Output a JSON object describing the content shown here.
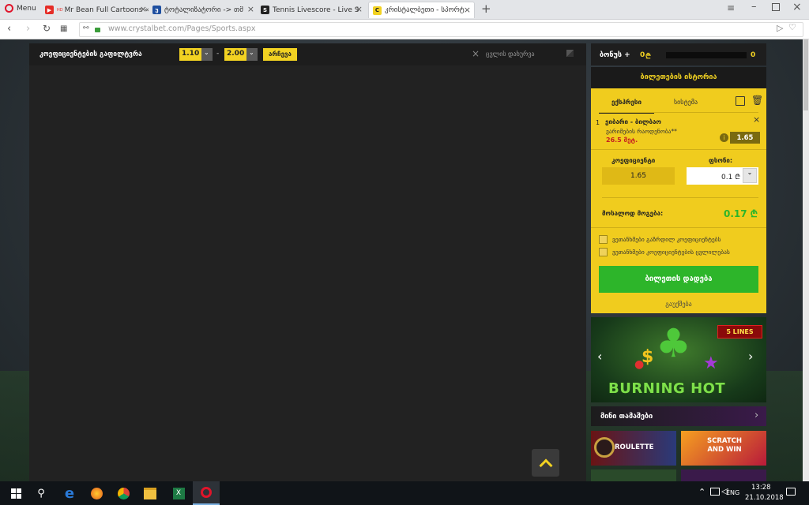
{
  "browser": {
    "menu_label": "Menu",
    "tabs": [
      {
        "title": "Mr Bean Full Cartoons «",
        "icon": "youtube-icon",
        "badge": "HD"
      },
      {
        "title": "ტოტალიზატორი -> თმ",
        "icon": "crystalbet-icon"
      },
      {
        "title": "Tennis Livescore - Live Sco",
        "icon": "livescore-icon"
      },
      {
        "title": "კრისტალბეთი - სპორტ",
        "icon": "crystalbet-icon"
      }
    ],
    "url": "www.crystalbet.com/Pages/Sports.aspx"
  },
  "filter": {
    "label": "კოეფიციენტების გაფილტვრა",
    "min": "1.10",
    "dash": "-",
    "max": "2.00",
    "apply_button": "არჩევა",
    "clear_label": "ცვლის დახურვა"
  },
  "bonus": {
    "label": "ბონუს +",
    "value": "0",
    "currency": "₾",
    "right_value": "0",
    "progress": 0
  },
  "betslip": {
    "history_title": "ბილეთების ისტორია",
    "tabs": [
      "ექსპრესი",
      "სისტემა"
    ],
    "bet": {
      "number": "1",
      "match": "ეიბარი - ბილბაო",
      "market": "ვარიმების რაოდენობა**",
      "selection": "26.5 მეტ.",
      "odds": "1.65"
    },
    "coef_label": "კოეფიციენტი",
    "stake_label": "ფსონი:",
    "coef_value": "1.65",
    "stake_value": "0.1 ₾",
    "payout_label": "მოსალოდ მოგება:",
    "payout_value": "0.17 ₾",
    "checkbox_1": "ვეთანხმები გაზრდილ კოეფიციენტებს",
    "checkbox_2": "ვეთანხმები კოეფიციენტების ცვლილებას",
    "place_bet": "ბილეთის დადება",
    "clear": "გაუქმება"
  },
  "promo": {
    "lines_badge": "5 LINES",
    "game_title": "BURNING HOT",
    "mini_games_title": "მინი თამაშები",
    "roulette": "ROULETTE",
    "scratch": "SCRATCH AND WIN"
  },
  "taskbar": {
    "lang": "ENG",
    "time": "13:28",
    "date": "21.10.2018"
  },
  "colors": {
    "accent_yellow": "#f2d222",
    "green": "#2db52a",
    "dark_bg": "#222222"
  }
}
